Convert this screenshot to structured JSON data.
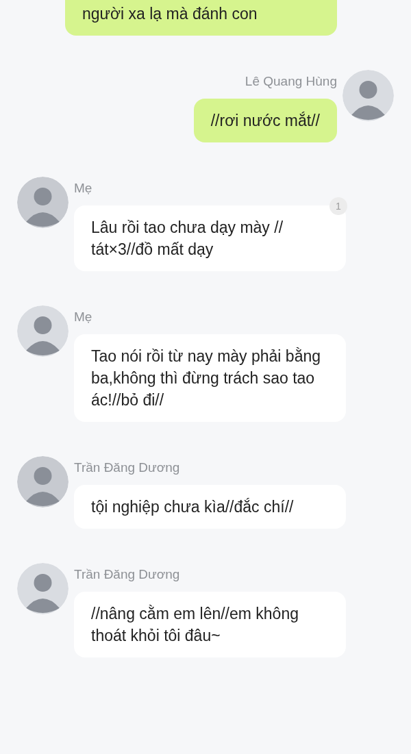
{
  "messages": [
    {
      "kind": "outgoing",
      "text": "người xa lạ mà đánh con"
    },
    {
      "kind": "outgoing",
      "sender": "Lê Quang Hùng",
      "text": "//rơi nước mắt//"
    },
    {
      "kind": "incoming",
      "sender": "Mẹ",
      "text": "Lâu rồi tao chưa dạy mày // tát×3//đồ mất dạy",
      "badge": "1"
    },
    {
      "kind": "incoming",
      "sender": "Mẹ",
      "text": "Tao nói rồi từ nay mày phải bằng ba,không thì đừng trách sao tao ác!//bỏ đi//"
    },
    {
      "kind": "incoming",
      "sender": "Trần Đăng Dương",
      "text": "tội nghiệp chưa kìa//đắc chí//"
    },
    {
      "kind": "incoming",
      "sender": "Trần Đăng Dương",
      "text": "//nâng cằm em lên//em không thoát khỏi tôi đâu~"
    }
  ]
}
